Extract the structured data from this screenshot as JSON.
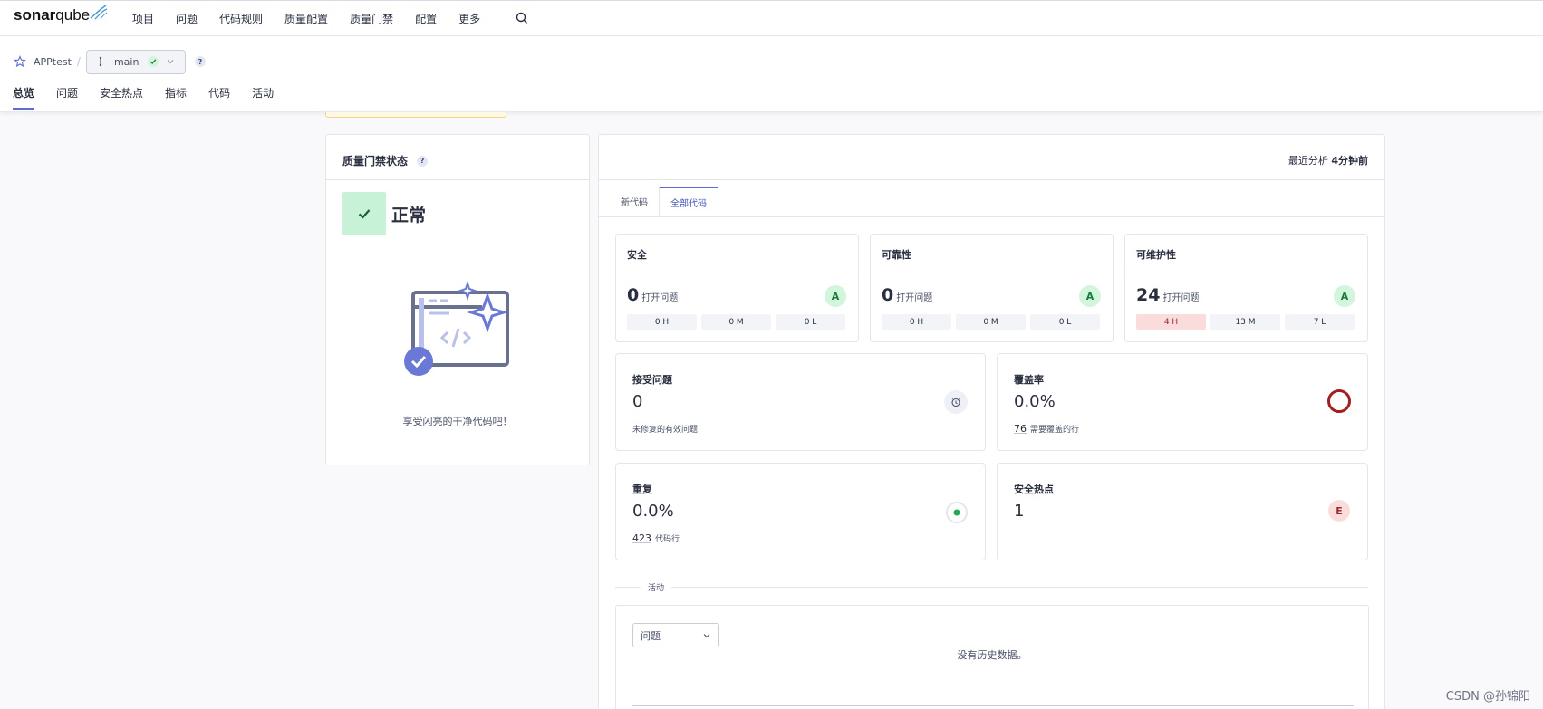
{
  "brand": {
    "name_bold": "sonar",
    "name_light": "qube"
  },
  "nav": {
    "items": [
      "项目",
      "问题",
      "代码规则",
      "质量配置",
      "质量门禁",
      "配置",
      "更多"
    ]
  },
  "project": {
    "name": "APPtest",
    "branch": "main",
    "help": "?",
    "tabs": [
      "总览",
      "问题",
      "安全热点",
      "指标",
      "代码",
      "活动"
    ]
  },
  "quality_gate": {
    "title": "质量门禁状态",
    "help": "?",
    "status": "正常",
    "caption": "享受闪亮的干净代码吧！"
  },
  "analysis": {
    "label": "最近分析",
    "value": "4分钟前"
  },
  "code_tabs": [
    "新代码",
    "全部代码"
  ],
  "metrics": {
    "security": {
      "title": "安全",
      "count": "0",
      "count_label": "打开问题",
      "grade": "A",
      "sev": [
        "0 H",
        "0 M",
        "0 L"
      ]
    },
    "reliability": {
      "title": "可靠性",
      "count": "0",
      "count_label": "打开问题",
      "grade": "A",
      "sev": [
        "0 H",
        "0 M",
        "0 L"
      ]
    },
    "maintainability": {
      "title": "可维护性",
      "count": "24",
      "count_label": "打开问题",
      "grade": "A",
      "sev": [
        "4 H",
        "13 M",
        "7 L"
      ]
    }
  },
  "accepted": {
    "title": "接受问题",
    "value": "0",
    "sub": "未修复的有效问题"
  },
  "coverage": {
    "title": "覆盖率",
    "value": "0.0%",
    "lines": "76",
    "lines_label": "需要覆盖的行"
  },
  "duplication": {
    "title": "重复",
    "value": "0.0%",
    "lines": "423",
    "lines_label": "代码行"
  },
  "hotspots": {
    "title": "安全热点",
    "value": "1",
    "grade": "E"
  },
  "activity": {
    "label": "活动",
    "select": "问题",
    "empty": "没有历史数据。"
  },
  "watermark": "CSDN @孙锦阳"
}
